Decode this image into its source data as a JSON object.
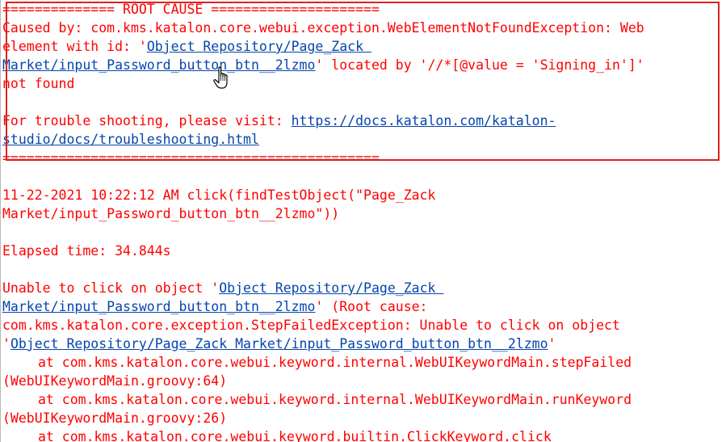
{
  "console": {
    "root_cause": {
      "header": "============== ROOT CAUSE =====================",
      "l1": "Caused by: com.kms.katalon.core.webui.exception.WebElementNotFoundException: Web",
      "l2_pre": "element with id: '",
      "l2_link": "Object Repository/Page_Zack ",
      "l3_link": "Market/input_Password_button_btn__2lzmo",
      "l3_post": "' located by '//*[@value = 'Signing_in']'",
      "l4": "not found",
      "l6_pre": "For trouble shooting, please visit: ",
      "l6_link": "https://docs.katalon.com/katalon-",
      "l7_link": "studio/docs/troubleshooting.html",
      "footer": "==============================================="
    },
    "step": {
      "l1": "11-22-2021 10:22:12 AM click(findTestObject(\"Page_Zack",
      "l2": "Market/input_Password_button_btn__2lzmo\"))"
    },
    "elapsed": "Elapsed time: 34.844s",
    "error": {
      "l1_pre": "Unable to click on object '",
      "l1_link": "Object Repository/Page_Zack ",
      "l2_link": "Market/input_Password_button_btn__2lzmo",
      "l2_post": "' (Root cause:",
      "l3": "com.kms.katalon.core.exception.StepFailedException: Unable to click on object",
      "l4_pre": "'",
      "l4_link": "Object Repository/Page_Zack Market/input_Password_button_btn__2lzmo",
      "l4_post": "'",
      "l5": "at com.kms.katalon.core.webui.keyword.internal.WebUIKeywordMain.stepFailed",
      "l6": "(WebUIKeywordMain.groovy:64)",
      "l7": "at com.kms.katalon.core.webui.keyword.internal.WebUIKeywordMain.runKeyword",
      "l8": "(WebUIKeywordMain.groovy:26)",
      "l9": "at com.kms.katalon.core.webui.keyword.builtin.ClickKeyword.click"
    }
  },
  "colors": {
    "error_text": "#ff0000",
    "link": "#0645ad",
    "highlight_box": "#e02020"
  },
  "icons": {
    "cursor": "hand-pointer-icon"
  }
}
